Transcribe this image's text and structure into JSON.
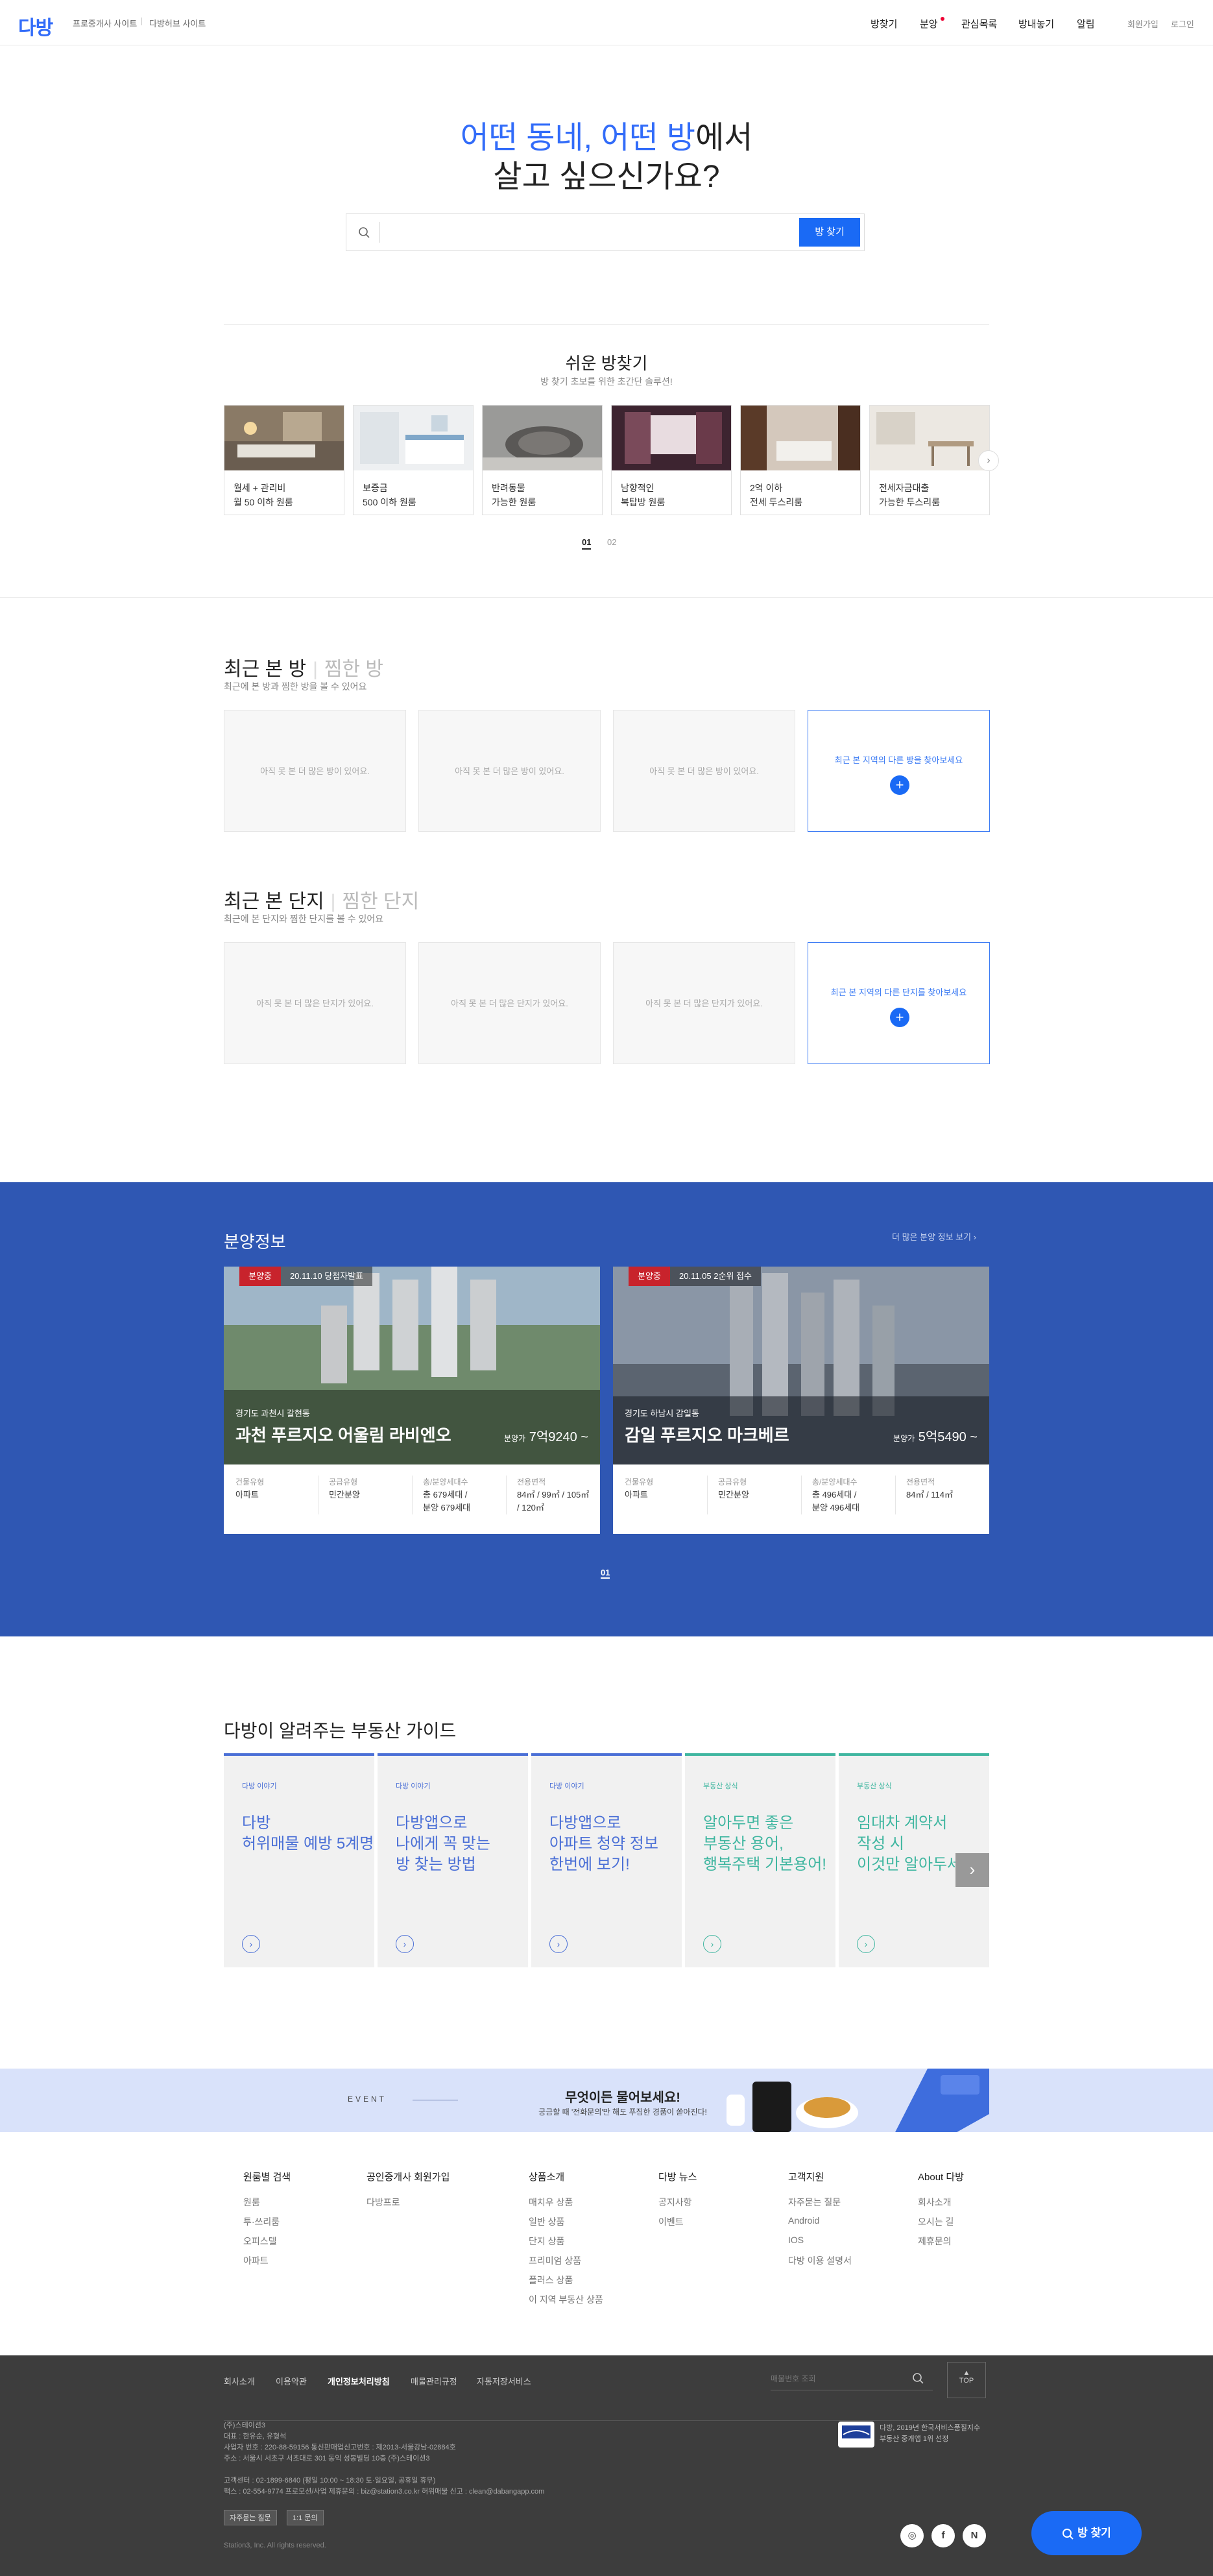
{
  "header": {
    "logo": "다방",
    "links": [
      "프로중개사 사이트",
      "다방허브 사이트"
    ],
    "nav": [
      "방찾기",
      "분양",
      "관심목록",
      "방내놓기",
      "알림"
    ],
    "auth": [
      "회원가입",
      "로그인"
    ]
  },
  "hero": {
    "line1_blue1": "어떤 동네, ",
    "line1_blue2": "어떤 방",
    "line1_rest": "에서",
    "line2": "살고 싶으신가요?",
    "search_placeholder": "",
    "search_button": "방 찾기"
  },
  "easy": {
    "title": "쉬운 방찾기",
    "subtitle": "방 찾기 초보를 위한 초간단 솔루션!",
    "cards": [
      {
        "label": "월세 + 관리비\n월 50 이하 원룸"
      },
      {
        "label": "보증금\n500 이하 원룸"
      },
      {
        "label": "반려동물\n가능한 원룸"
      },
      {
        "label": "남향적인\n복탑방 원룸"
      },
      {
        "label": "2억 이하\n전세 투스리룸"
      },
      {
        "label": "전세자금대출\n가능한 투스리룸"
      }
    ],
    "pages": [
      "01",
      "02"
    ]
  },
  "recent_rooms": {
    "title": "최근 본 방",
    "title_sub": "찜한 방",
    "subtitle": "최근에 본 방과 찜한 방을 볼 수 있어요",
    "empty": "아직 못 본 더 많은 방이 있어요.",
    "find": "최근 본 지역의 다른 방을 찾아보세요"
  },
  "recent_complex": {
    "title": "최근 본 단지",
    "title_sub": "찜한 단지",
    "subtitle": "최근에 본 단지와 찜한 단지를 볼 수 있어요",
    "empty": "아직 못 본 더 많은 단지가 있어요.",
    "find": "최근 본 지역의 다른 단지를 찾아보세요"
  },
  "bunyang": {
    "title": "분양정보",
    "more": "더 많은 분양 정보 보기 ›",
    "cards": [
      {
        "tag": "분양중",
        "date": "20.11.10 당첨자발표",
        "loc": "경기도 과천시 갈현동",
        "name": "과천 푸르지오 어울림 라비엔오",
        "price_label": "분양가",
        "price": "7억9240 ~",
        "info": [
          {
            "k": "건물유형",
            "v": "아파트"
          },
          {
            "k": "공급유형",
            "v": "민간분양"
          },
          {
            "k": "총/분양세대수",
            "v": "총 679세대 /\n분양 679세대"
          },
          {
            "k": "전용면적",
            "v": "84㎡ / 99㎡ / 105㎡\n/ 120㎡"
          }
        ]
      },
      {
        "tag": "분양중",
        "date": "20.11.05 2순위 접수",
        "loc": "경기도 하남시 감일동",
        "name": "감일 푸르지오 마크베르",
        "price_label": "분양가",
        "price": "5억5490 ~",
        "info": [
          {
            "k": "건물유형",
            "v": "아파트"
          },
          {
            "k": "공급유형",
            "v": "민간분양"
          },
          {
            "k": "총/분양세대수",
            "v": "총 496세대 /\n분양 496세대"
          },
          {
            "k": "전용면적",
            "v": "84㎡ / 114㎡"
          }
        ]
      }
    ],
    "page": "01"
  },
  "guide": {
    "title": "다방이 알려주는 부동산 가이드",
    "cards": [
      {
        "cat": "다방 이야기",
        "title": "다방\n허위매물 예방 5계명",
        "color": "#4a6fd6"
      },
      {
        "cat": "다방 이야기",
        "title": "다방앱으로\n나에게 꼭 맞는\n방 찾는 방법",
        "color": "#4a6fd6"
      },
      {
        "cat": "다방 이야기",
        "title": "다방앱으로\n아파트 청약 정보\n한번에 보기!",
        "color": "#4a6fd6"
      },
      {
        "cat": "부동산 상식",
        "title": "알아두면 좋은\n부동산 용어,\n행복주택 기본용어!",
        "color": "#3fb6a0"
      },
      {
        "cat": "부동산 상식",
        "title": "임대차 계약서\n작성 시\n이것만 알아두세요!",
        "color": "#3fb6a0"
      }
    ]
  },
  "event": {
    "label": "EVENT",
    "title": "무엇이든 물어보세요!",
    "subtitle": "궁금할 때 '전화문의'만 해도 푸짐한 경품이 쏟아진다!"
  },
  "footer_links": [
    {
      "title": "원룸별 검색",
      "items": [
        "원룸",
        "투·쓰리룸",
        "오피스텔",
        "아파트"
      ]
    },
    {
      "title": "공인중개사 회원가입",
      "items": [
        "다방프로"
      ]
    },
    {
      "title": "상품소개",
      "items": [
        "매치우 상품",
        "일반 상품",
        "단지 상품",
        "프리미엄 상품",
        "플러스 상품",
        "이 지역 부동산 상품"
      ]
    },
    {
      "title": "다방 뉴스",
      "items": [
        "공지사항",
        "이벤트"
      ]
    },
    {
      "title": "고객지원",
      "items": [
        "자주묻는 질문",
        "Android",
        "IOS",
        "다방 이용 설명서"
      ]
    },
    {
      "title": "About 다방",
      "items": [
        "회사소개",
        "오시는 길",
        "제휴문의"
      ]
    }
  ],
  "footer": {
    "nav": [
      "회사소개",
      "이용약관",
      "개인정보처리방침",
      "매물관리규정",
      "자동저장서비스"
    ],
    "search_placeholder": "매물번호 조회",
    "top": "TOP",
    "company_lines": [
      "(주)스테이션3",
      "대표 : 한유순, 유형석",
      "사업자 번호 : 220-88-59156   통신판매업신고번호 : 제2013-서울강남-02884호",
      "주소 : 서울시 서초구 서초대로 301 동익 성봉빌딩 10층 (주)스테이션3",
      "고객센터 : 02-1899-6840 (평일 10:00 ~ 18:30 토·일요일, 공휴일 휴무)",
      "팩스 : 02-554-9774     프로모션/사업 제휴문의 : biz@station3.co.kr     허위매물 신고 : clean@dabangapp.com"
    ],
    "buttons": [
      "자주묻는 질문",
      "1:1 문의"
    ],
    "copyright": "Station3, Inc. All rights reserved.",
    "award": "다방, 2019년 한국서비스품질지수\n부동산 중개앱 1위 선정",
    "sns": [
      "instagram-icon",
      "facebook-icon",
      "naver-icon"
    ],
    "float_button": "방 찾기"
  }
}
